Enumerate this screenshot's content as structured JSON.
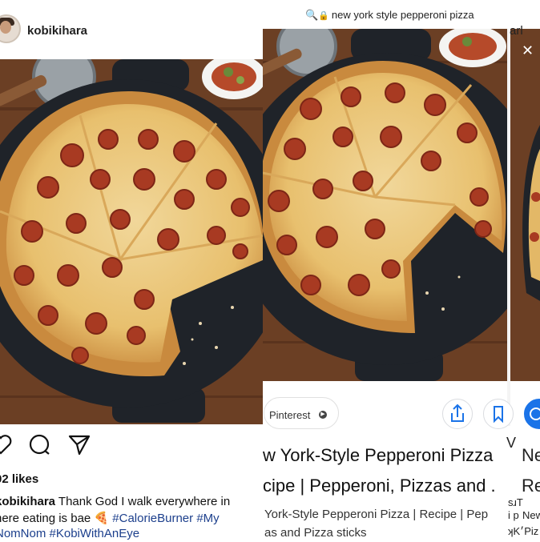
{
  "instagram": {
    "username": "kobikihara",
    "likes": "02 likes",
    "caption_user": "kobikihara",
    "caption_line1_text": " Thank God I walk everywhere in",
    "caption_line2_text": "here eating is bae 🍕 ",
    "caption_line2_tag": "#CalorieBurner #My",
    "caption_line3_tags": "NomNom #KobiWithAnEye",
    "icons": [
      "heart-icon",
      "comment-icon",
      "share-icon"
    ]
  },
  "google": {
    "search_query": "new york style pepperoni pizza",
    "source_chip": "Pinterest",
    "title_line1": "w York-Style Pepperoni Pizza",
    "title_line2": "cipe | Pepperoni, Pizzas and .",
    "sub_line1": "York-Style Pepperoni Pizza | Recipe | Pep",
    "sub_line2": "as and Pizza sticks",
    "icons": [
      "lock-icon",
      "share-icon",
      "bookmark-icon",
      "close-icon"
    ]
  },
  "right_sliver": {
    "url_fragment": "arl",
    "close": "✕",
    "title_frag1": "Ne",
    "title_frag2": "Re",
    "sub_frag1": "i p",
    "sub_frag2": "sɹT",
    "sub_frag3": "New",
    "sub_frag4": "ʞK׳Piz",
    "icon_frag": "V"
  },
  "colors": {
    "hashtag": "#1c3f8c",
    "pan": "#1f2329",
    "wood": "#6b3f24"
  }
}
